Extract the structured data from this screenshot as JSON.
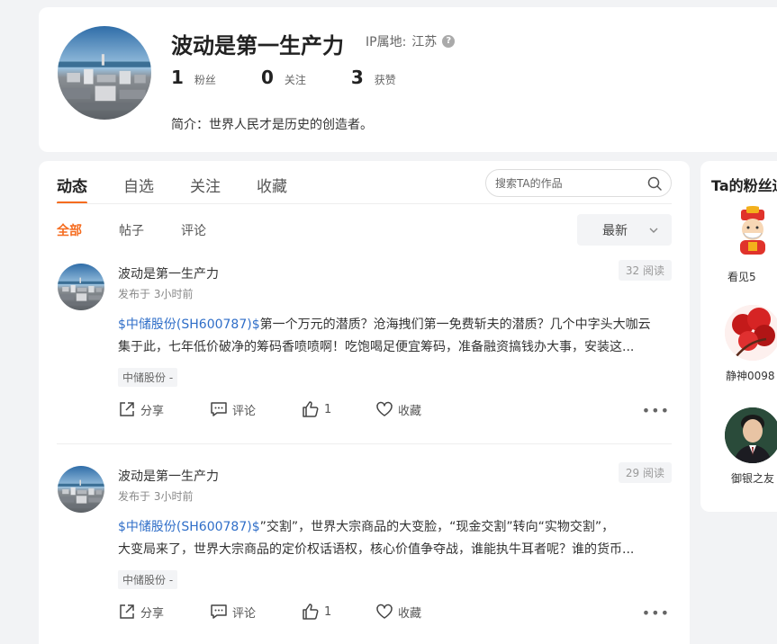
{
  "profile": {
    "name": "波动是第一生产力",
    "ip_label": "IP属地:",
    "ip_location": "江苏",
    "stats": [
      {
        "num": "1",
        "label": "粉丝"
      },
      {
        "num": "0",
        "label": "关注"
      },
      {
        "num": "3",
        "label": "获赞"
      }
    ],
    "bio": "简介：世界人民才是历史的创造者。"
  },
  "tabs": [
    "动态",
    "自选",
    "关注",
    "收藏"
  ],
  "search": {
    "placeholder": "搜索TA的作品"
  },
  "subtabs": [
    "全部",
    "帖子",
    "评论"
  ],
  "sort": {
    "label": "最新"
  },
  "posts": [
    {
      "author": "波动是第一生产力",
      "time": "发布于 3小时前",
      "reads": "32 阅读",
      "stock": "$中储股份(SH600787)$",
      "line1_rest": "第一个万元的潜质？沧海拽们第一免费斩夫的潜质？几个中字头大咖云",
      "line2": "集于此，七年低价破净的筹码香喷喷啊！吃饱喝足便宜筹码，准备融资搞钱办大事，安装这...",
      "tag": "中储股份 -",
      "share": "分享",
      "comment": "评论",
      "likes": "1",
      "fav": "收藏"
    },
    {
      "author": "波动是第一生产力",
      "time": "发布于 3小时前",
      "reads": "29 阅读",
      "stock": "$中储股份(SH600787)$",
      "line1_rest": "”交割”，世界大宗商品的大变脸，“现金交割”转向“实物交割”，",
      "line2": "大变局来了，世界大宗商品的定价权话语权，核心价值争夺战，谁能执牛耳者呢？谁的货币...",
      "tag": "中储股份 -",
      "share": "分享",
      "comment": "评论",
      "likes": "1",
      "fav": "收藏"
    }
  ],
  "fans": {
    "title": "Ta的粉丝通",
    "items": [
      {
        "name": "看见5"
      },
      {
        "name": "静神0098"
      },
      {
        "name": "御银之友"
      }
    ]
  },
  "colors": {
    "accent": "#f56c1f",
    "link": "#2f6ec8"
  }
}
